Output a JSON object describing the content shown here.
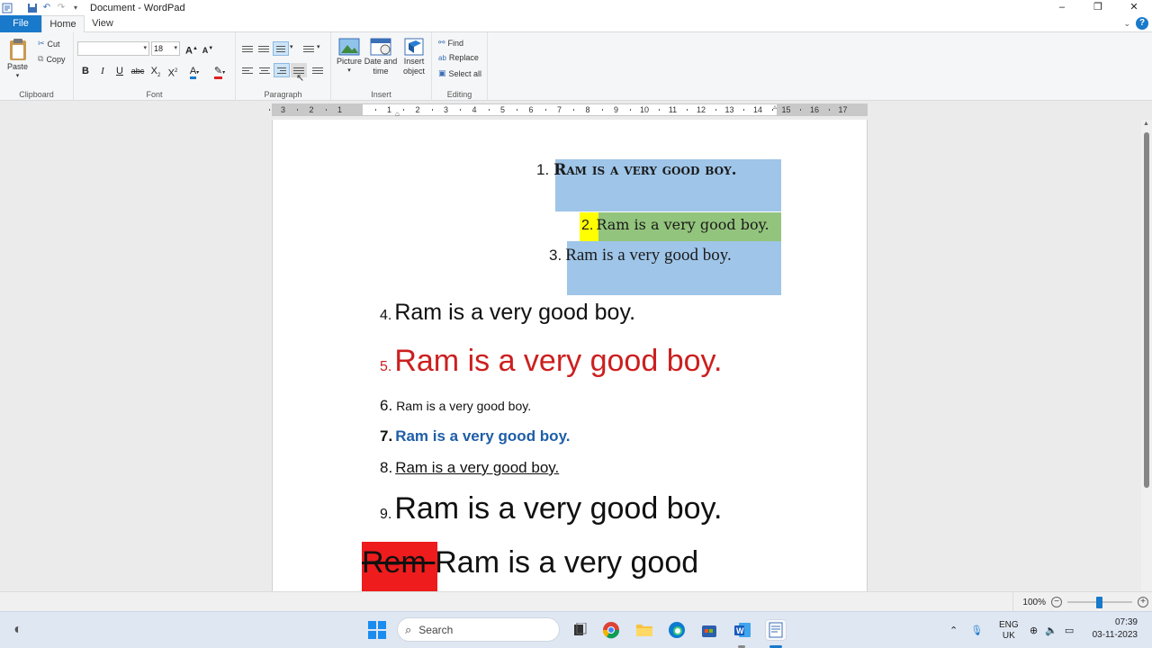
{
  "window": {
    "title": "Document - WordPad",
    "minimize": "–",
    "restore": "❐",
    "close": "✕"
  },
  "tabs": {
    "file": "File",
    "home": "Home",
    "view": "View"
  },
  "ribbon": {
    "clipboard": {
      "paste": "Paste",
      "cut": "Cut",
      "copy": "Copy",
      "label": "Clipboard"
    },
    "font": {
      "family": "",
      "size": "18",
      "label": "Font"
    },
    "paragraph": {
      "label": "Paragraph"
    },
    "insert": {
      "picture": "Picture",
      "date_time": "Date and time",
      "insert_object": "Insert object",
      "label": "Insert"
    },
    "editing": {
      "find": "Find",
      "replace": "Replace",
      "select_all": "Select all",
      "label": "Editing"
    }
  },
  "ruler": {
    "numbers": [
      "3",
      "2",
      "1",
      "1",
      "2",
      "3",
      "4",
      "5",
      "6",
      "7",
      "8",
      "9",
      "10",
      "11",
      "12",
      "13",
      "14",
      "15",
      "16",
      "17"
    ]
  },
  "document": {
    "lines": [
      {
        "num": "1.",
        "text": "Ram is a very good boy."
      },
      {
        "num": "2.",
        "text": "Ram is a very good boy."
      },
      {
        "num": "3.",
        "text": "Ram is a very good boy."
      },
      {
        "num": "4.",
        "text": "Ram is a very good boy."
      },
      {
        "num": "5.",
        "text": "Ram is a very good boy."
      },
      {
        "num": "6.",
        "text": "Ram is a very good boy."
      },
      {
        "num": "7.",
        "text": "Ram is a very good boy."
      },
      {
        "num": "8.",
        "text": "Ram is a very good boy."
      },
      {
        "num": "9.",
        "text": "Ram is a very good boy."
      },
      {
        "struck": "Rem ",
        "text": "Ram is a very good"
      }
    ]
  },
  "status": {
    "zoom": "100%",
    "minus": "−",
    "plus": "+"
  },
  "taskbar": {
    "search": "Search",
    "lang_top": "ENG",
    "lang_bottom": "UK",
    "time": "07:39",
    "date": "03-11-2023"
  },
  "colors": {
    "accent": "#1979ca",
    "highlight_blue": "#9fc5e8",
    "highlight_green": "#93c47d",
    "highlight_yellow": "#ffff00",
    "red_text": "#cc1f1f",
    "blue_text": "#1f5ea8",
    "red_highlight": "#ee1c1c"
  }
}
